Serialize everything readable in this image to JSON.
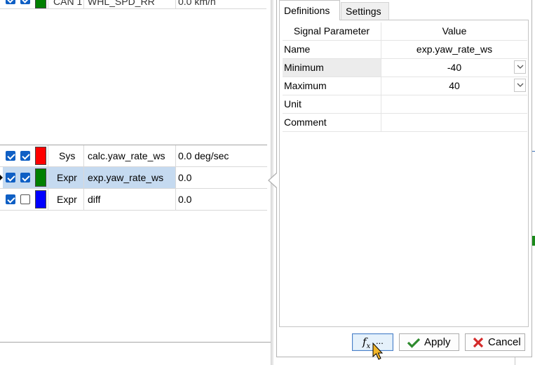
{
  "signals_top_partial": {
    "source": "CAN 1",
    "name": "WHL_SPD_RR",
    "value": "0.0 km/h",
    "color": "#008000"
  },
  "signals": [
    {
      "checked_a": true,
      "checked_b": true,
      "color": "#ff0000",
      "type": "Sys",
      "name": "calc.yaw_rate_ws",
      "value": "0.0 deg/sec",
      "selected": false
    },
    {
      "checked_a": true,
      "checked_b": true,
      "color": "#008000",
      "type": "Expr",
      "name": "exp.yaw_rate_ws",
      "value": "0.0",
      "selected": true
    },
    {
      "checked_a": true,
      "checked_b": false,
      "color": "#0000ff",
      "type": "Expr",
      "name": "diff",
      "value": "0.0",
      "selected": false
    }
  ],
  "popup": {
    "tabs": [
      {
        "label": "Definitions",
        "active": true
      },
      {
        "label": "Settings",
        "active": false
      }
    ],
    "grid_headers": {
      "param": "Signal Parameter",
      "value": "Value"
    },
    "rows": [
      {
        "param": "Name",
        "value": "exp.yaw_rate_ws",
        "dropdown": false
      },
      {
        "param": "Minimum",
        "value": "-40",
        "dropdown": true
      },
      {
        "param": "Maximum",
        "value": "40",
        "dropdown": true
      },
      {
        "param": "Unit",
        "value": "",
        "dropdown": false
      },
      {
        "param": "Comment",
        "value": "",
        "dropdown": false
      }
    ],
    "buttons": {
      "fx": "fx...",
      "apply": "Apply",
      "cancel": "Cancel"
    }
  },
  "icons": [
    "checkmark-icon",
    "x-icon",
    "function-icon",
    "cursor-icon",
    "chevron-down-icon"
  ],
  "colors": {
    "accent": "#0f5fc4",
    "apply_green": "#2e8b2e",
    "cancel_red": "#d42a2a",
    "selection": "#c5daf0"
  }
}
